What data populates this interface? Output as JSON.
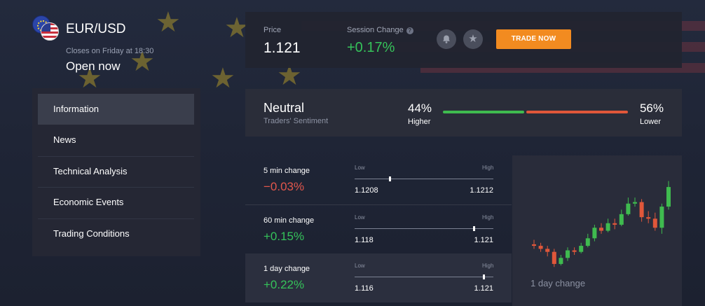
{
  "pair": {
    "title": "EUR/USD",
    "closes": "Closes on Friday at 18:30",
    "status": "Open now"
  },
  "price": {
    "label": "Price",
    "value": "1.121",
    "session_label": "Session Change",
    "session_help": "?",
    "session_value": "+0.17%",
    "bell_icon": "bell-icon",
    "star_icon": "star-icon",
    "trade_label": "TRADE NOW",
    "accent": "#f28b20"
  },
  "sidebar": {
    "items": [
      {
        "label": "Information",
        "active": true
      },
      {
        "label": "News"
      },
      {
        "label": "Technical Analysis"
      },
      {
        "label": "Economic Events"
      },
      {
        "label": "Trading Conditions"
      }
    ]
  },
  "sentiment": {
    "title": "Neutral",
    "subtitle": "Traders' Sentiment",
    "higher_pct": "44%",
    "higher_label": "Higher",
    "lower_pct": "56%",
    "lower_label": "Lower",
    "higher_fraction": 0.44,
    "higher_color": "#3fbb4f",
    "lower_color": "#e0573a"
  },
  "changes": [
    {
      "label": "5 min change",
      "value": "−0.03%",
      "direction": "neg",
      "low_label": "Low",
      "high_label": "High",
      "low": "1.1208",
      "high": "1.1212",
      "position": 0.25
    },
    {
      "label": "60 min change",
      "value": "+0.15%",
      "direction": "pos",
      "low_label": "Low",
      "high_label": "High",
      "low": "1.118",
      "high": "1.121",
      "position": 0.86
    },
    {
      "label": "1 day change",
      "value": "+0.22%",
      "direction": "pos",
      "low_label": "Low",
      "high_label": "High",
      "low": "1.116",
      "high": "1.121",
      "position": 0.93
    }
  ],
  "chart": {
    "caption": "1 day change",
    "up_color": "#3fbb4f",
    "down_color": "#e0573a",
    "candles": [
      {
        "o": 45,
        "c": 44,
        "h": 48,
        "l": 42
      },
      {
        "o": 44,
        "c": 42,
        "h": 46,
        "l": 40
      },
      {
        "o": 42,
        "c": 40,
        "h": 44,
        "l": 37
      },
      {
        "o": 40,
        "c": 32,
        "h": 42,
        "l": 30
      },
      {
        "o": 32,
        "c": 36,
        "h": 38,
        "l": 31
      },
      {
        "o": 36,
        "c": 41,
        "h": 43,
        "l": 34
      },
      {
        "o": 41,
        "c": 40,
        "h": 43,
        "l": 38
      },
      {
        "o": 40,
        "c": 44,
        "h": 46,
        "l": 39
      },
      {
        "o": 44,
        "c": 49,
        "h": 52,
        "l": 43
      },
      {
        "o": 49,
        "c": 56,
        "h": 58,
        "l": 47
      },
      {
        "o": 56,
        "c": 54,
        "h": 59,
        "l": 52
      },
      {
        "o": 54,
        "c": 59,
        "h": 62,
        "l": 53
      },
      {
        "o": 59,
        "c": 58,
        "h": 62,
        "l": 55
      },
      {
        "o": 58,
        "c": 65,
        "h": 68,
        "l": 57
      },
      {
        "o": 65,
        "c": 72,
        "h": 76,
        "l": 64
      },
      {
        "o": 72,
        "c": 73,
        "h": 76,
        "l": 70
      },
      {
        "o": 73,
        "c": 63,
        "h": 75,
        "l": 60
      },
      {
        "o": 63,
        "c": 62,
        "h": 67,
        "l": 59
      },
      {
        "o": 62,
        "c": 56,
        "h": 66,
        "l": 54
      },
      {
        "o": 56,
        "c": 70,
        "h": 72,
        "l": 52
      },
      {
        "o": 70,
        "c": 83,
        "h": 87,
        "l": 68
      }
    ]
  }
}
